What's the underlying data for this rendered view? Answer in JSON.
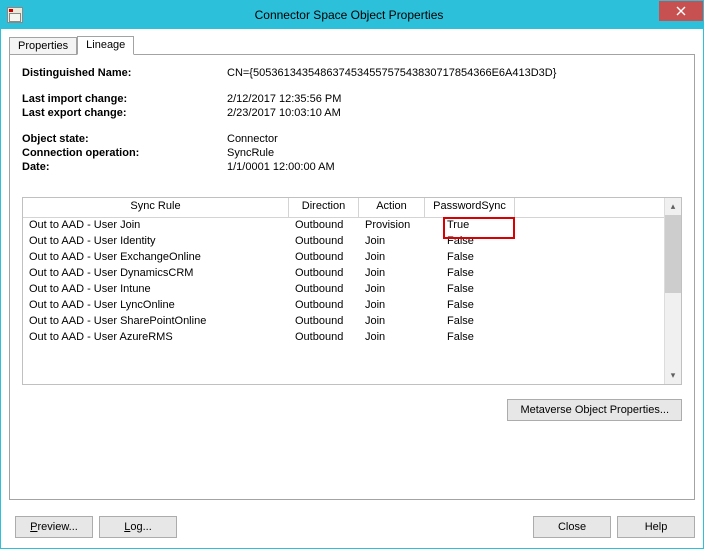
{
  "window": {
    "title": "Connector Space Object Properties"
  },
  "tabs": {
    "properties": "Properties",
    "lineage": "Lineage"
  },
  "fields": {
    "dn_label": "Distinguished Name:",
    "dn_value": "CN={505361343548637453455757543830717854366E6A413D3D}",
    "last_import_label": "Last import change:",
    "last_import_value": "2/12/2017 12:35:56 PM",
    "last_export_label": "Last export change:",
    "last_export_value": "2/23/2017 10:03:10 AM",
    "object_state_label": "Object state:",
    "object_state_value": "Connector",
    "conn_op_label": "Connection operation:",
    "conn_op_value": "SyncRule",
    "date_label": "Date:",
    "date_value": "1/1/0001 12:00:00 AM"
  },
  "table": {
    "headers": {
      "rule": "Sync Rule",
      "direction": "Direction",
      "action": "Action",
      "pwsync": "PasswordSync"
    },
    "rows": [
      {
        "rule": "Out to AAD - User Join",
        "direction": "Outbound",
        "action": "Provision",
        "pwsync": "True",
        "hl": true
      },
      {
        "rule": "Out to AAD - User Identity",
        "direction": "Outbound",
        "action": "Join",
        "pwsync": "False"
      },
      {
        "rule": "Out to AAD - User ExchangeOnline",
        "direction": "Outbound",
        "action": "Join",
        "pwsync": "False"
      },
      {
        "rule": "Out to AAD - User DynamicsCRM",
        "direction": "Outbound",
        "action": "Join",
        "pwsync": "False"
      },
      {
        "rule": "Out to AAD - User Intune",
        "direction": "Outbound",
        "action": "Join",
        "pwsync": "False"
      },
      {
        "rule": "Out to AAD - User LyncOnline",
        "direction": "Outbound",
        "action": "Join",
        "pwsync": "False"
      },
      {
        "rule": "Out to AAD - User SharePointOnline",
        "direction": "Outbound",
        "action": "Join",
        "pwsync": "False"
      },
      {
        "rule": "Out to AAD - User AzureRMS",
        "direction": "Outbound",
        "action": "Join",
        "pwsync": "False"
      }
    ]
  },
  "buttons": {
    "mv_props": "Metaverse Object Properties...",
    "preview": "Preview...",
    "log": "Log...",
    "close": "Close",
    "help": "Help"
  }
}
